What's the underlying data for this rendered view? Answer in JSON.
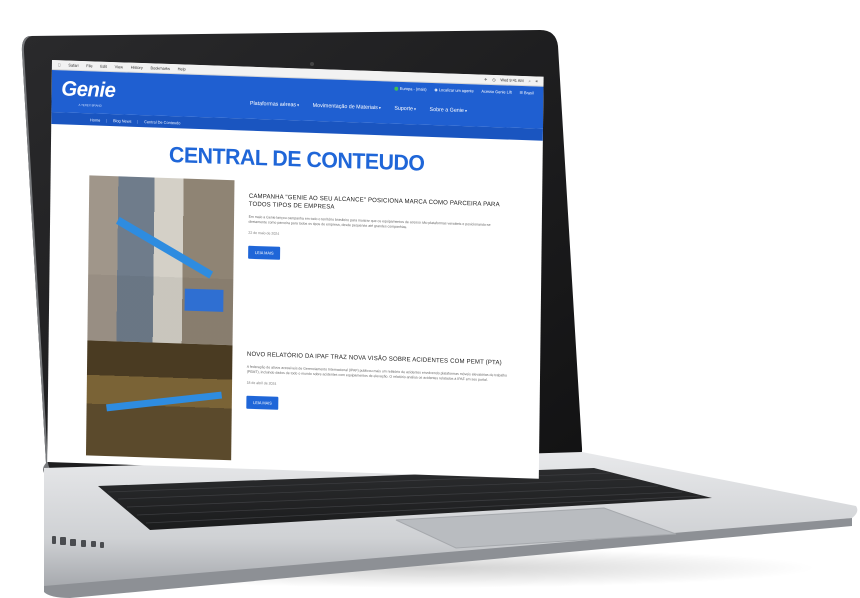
{
  "mac_menubar": {
    "items": [
      "Safari",
      "File",
      "Edit",
      "View",
      "History",
      "Bookmarks",
      "Help"
    ],
    "right": [
      "✈",
      "◷",
      "Wed 9:41 AM",
      "⌕",
      "≡"
    ]
  },
  "header": {
    "logo": "Genie",
    "logo_sub": "A TEREX BRAND",
    "util_links": [
      "Europa - (mais)",
      "Localizar um agente",
      "Acesso Genie Lift",
      "Brasil"
    ],
    "nav": [
      "Plataformas aéreas",
      "Movimentação de Materiais",
      "Suporte",
      "Sobre a Genie"
    ]
  },
  "breadcrumb": [
    "Home",
    "Blog News",
    "Central De Conteudo"
  ],
  "page": {
    "title": "CENTRAL DE CONTEUDO"
  },
  "articles": [
    {
      "title": "CAMPANHA \"GENIE AO SEU ALCANCE\" POSICIONA MARCA COMO PARCEIRA PARA TODOS TIPOS DE EMPRESA",
      "excerpt": "Em maio a Genie lançou campanha em todo o território brasileiro para mostrar que os equipamentos de acesso são plataformas versáteis e posicionando-se diretamente como parceira para todos os tipos de empresa, desde pequenas até grandes companhias.",
      "date": "22 de maio de 2024",
      "button": "LEIA MAIS"
    },
    {
      "title": "NOVO RELATÓRIO DA IPAF TRAZ NOVA VISÃO SOBRE ACIDENTES COM PEMT (PTA)",
      "excerpt": "A federação de ativos acessíveis de Gerenciamento Internacional (IPAF) publicou mais um relatório de acidentes envolvendo plataformas móveis elevatórias de trabalho (PEMT), incluindo dados de todo o mundo sobre acidentes com equipamentos de elevação. O relatório analisa os acidentes relatados à IPAF em seu portal.",
      "date": "18 de abril de 2024",
      "button": "LEIA MAIS"
    }
  ],
  "colors": {
    "brand_blue": "#1f5fd1",
    "title_blue": "#1f66d8",
    "laptop_silver": "#c9cbce",
    "bezel": "#1b1b1c"
  }
}
